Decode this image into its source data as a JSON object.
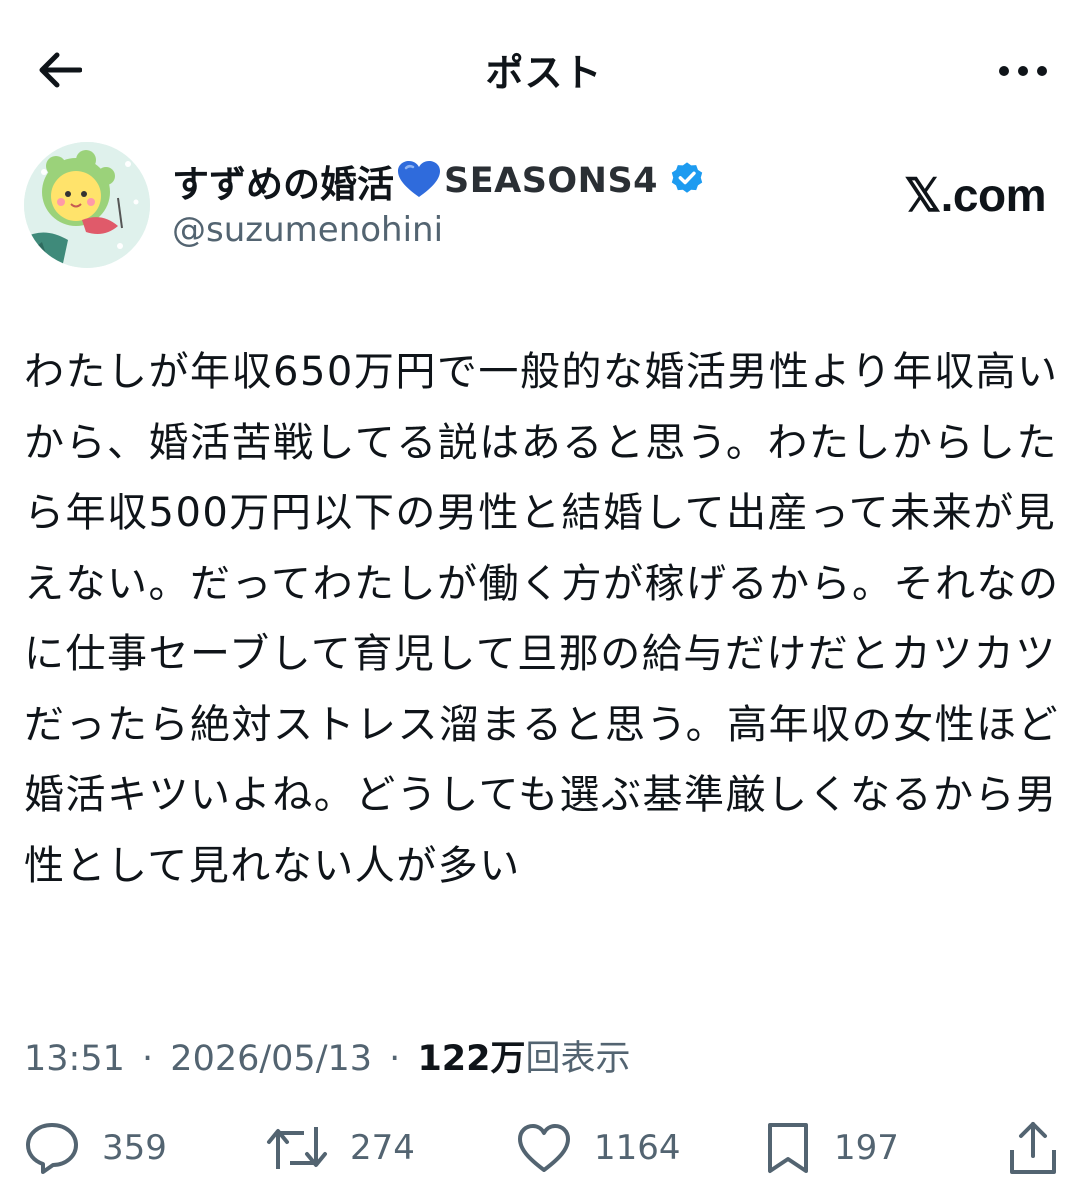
{
  "header": {
    "title": "ポスト"
  },
  "author": {
    "display_name": "すずめの婚活",
    "name_suffix": "SEASONS4",
    "handle": "@suzumenohini",
    "heart_color": "#2f6bdc",
    "verified_color": "#1d9bf0"
  },
  "brand": "𝕏.com",
  "post": {
    "text": "わたしが年収650万円で一般的な婚活男性より年収高いから、婚活苦戦してる説はあると思う。わたしからしたら年収500万円以下の男性と結婚して出産って未来が見えない。だってわたしが働く方が稼げるから。それなのに仕事セーブして育児して旦那の給与だけだとカツカツだったら絶対ストレス溜まると思う。高年収の女性ほど婚活キツいよね。どうしても選ぶ基準厳しくなるから男性として見れない人が多い"
  },
  "meta": {
    "time": "13:51",
    "separator": "·",
    "date": "2026/05/13",
    "views_count": "122万",
    "views_label": "回表示"
  },
  "actions": {
    "reply": {
      "icon": "reply-icon",
      "count": "359"
    },
    "repost": {
      "icon": "repost-icon",
      "count": "274"
    },
    "like": {
      "icon": "heart-icon",
      "count": "1164"
    },
    "bookmark": {
      "icon": "bookmark-icon",
      "count": "197"
    },
    "share": {
      "icon": "share-icon"
    }
  },
  "colors": {
    "text": "#0f1419",
    "secondary": "#536471",
    "accent": "#1d9bf0"
  }
}
